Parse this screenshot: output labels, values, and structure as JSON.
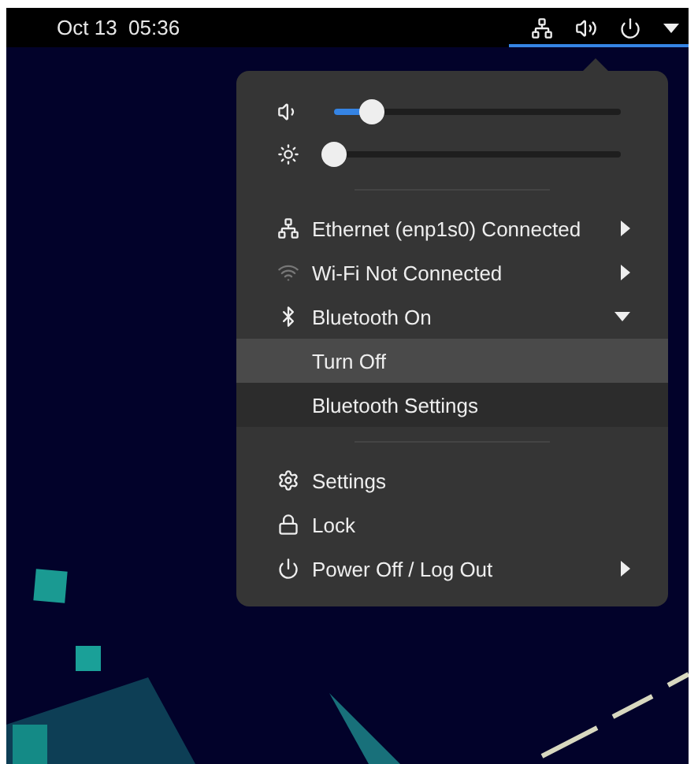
{
  "top_bar": {
    "clock": "Oct 13  05:36",
    "menu_open": true
  },
  "sliders": [
    {
      "kind": "volume",
      "level": 0.13
    },
    {
      "kind": "brightness",
      "level": 0
    }
  ],
  "network_items": [
    {
      "kind": "ethernet",
      "label": "Ethernet (enp1s0) Connected",
      "expanded": false
    },
    {
      "kind": "wifi",
      "label": "Wi-Fi Not Connected",
      "expanded": false
    },
    {
      "kind": "bluetooth",
      "label": "Bluetooth On",
      "expanded": true,
      "children": [
        {
          "label": "Turn Off",
          "selected": true
        },
        {
          "label": "Bluetooth Settings",
          "selected": false
        }
      ]
    }
  ],
  "system_items": [
    {
      "kind": "settings",
      "label": "Settings",
      "submenu": false
    },
    {
      "kind": "lock",
      "label": "Lock",
      "submenu": false
    },
    {
      "kind": "power",
      "label": "Power Off / Log Out",
      "submenu": true
    }
  ]
}
